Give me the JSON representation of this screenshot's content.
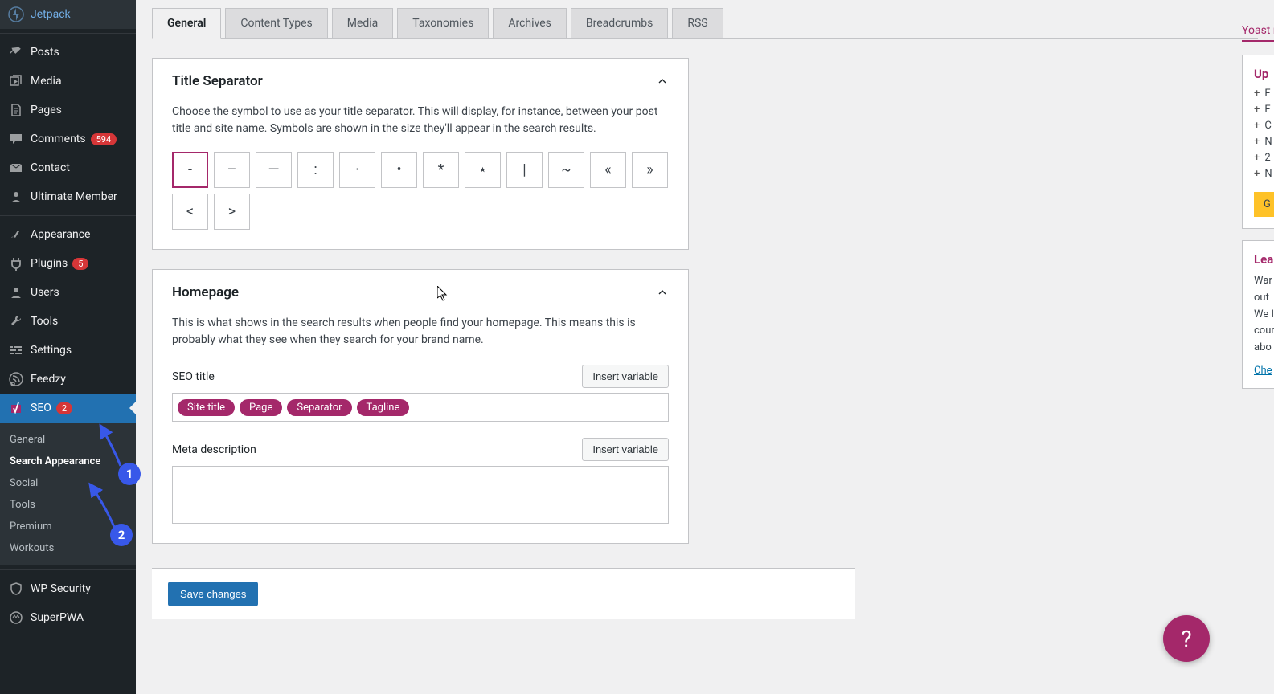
{
  "sidebar": {
    "items": [
      {
        "label": "Jetpack",
        "icon": "jetpack"
      },
      {
        "label": "Posts",
        "icon": "pin"
      },
      {
        "label": "Media",
        "icon": "media"
      },
      {
        "label": "Pages",
        "icon": "page"
      },
      {
        "label": "Comments",
        "icon": "comment",
        "badge": "594"
      },
      {
        "label": "Contact",
        "icon": "mail"
      },
      {
        "label": "Ultimate Member",
        "icon": "user"
      },
      {
        "label": "Appearance",
        "icon": "brush"
      },
      {
        "label": "Plugins",
        "icon": "plug",
        "badge": "5"
      },
      {
        "label": "Users",
        "icon": "users"
      },
      {
        "label": "Tools",
        "icon": "tools"
      },
      {
        "label": "Settings",
        "icon": "settings"
      },
      {
        "label": "Feedzy",
        "icon": "feedzy"
      },
      {
        "label": "SEO",
        "icon": "yoast",
        "badge": "2",
        "active": true
      },
      {
        "label": "WP Security",
        "icon": "shield"
      },
      {
        "label": "SuperPWA",
        "icon": "pwa"
      }
    ],
    "submenu": [
      {
        "label": "General"
      },
      {
        "label": "Search Appearance",
        "active": true
      },
      {
        "label": "Social"
      },
      {
        "label": "Tools"
      },
      {
        "label": "Premium"
      },
      {
        "label": "Workouts"
      }
    ]
  },
  "tabs": [
    "General",
    "Content Types",
    "Media",
    "Taxonomies",
    "Archives",
    "Breadcrumbs",
    "RSS"
  ],
  "active_tab": "General",
  "title_sep": {
    "heading": "Title Separator",
    "desc": "Choose the symbol to use as your title separator. This will display, for instance, between your post title and site name. Symbols are shown in the size they'll appear in the search results.",
    "options": [
      "-",
      "–",
      "—",
      ":",
      "·",
      "•",
      "*",
      "⋆",
      "|",
      "~",
      "«",
      "»",
      "<",
      ">"
    ],
    "selected": "-"
  },
  "homepage": {
    "heading": "Homepage",
    "desc": "This is what shows in the search results when people find your homepage. This means this is probably what they see when they search for your brand name.",
    "seo_title_label": "SEO title",
    "insert_var": "Insert variable",
    "chips": [
      "Site title",
      "Page",
      "Separator",
      "Tagline"
    ],
    "meta_label": "Meta description"
  },
  "save_label": "Save changes",
  "right": {
    "link": "Yoast re",
    "h1": "Up",
    "items": [
      "F",
      "F",
      "C",
      "N",
      "2",
      "N"
    ],
    "gold": "G",
    "h2": "Lea",
    "p2": "War out We I cour abo",
    "link2": "Che"
  },
  "help": "?",
  "callouts": {
    "1": "1",
    "2": "2"
  }
}
